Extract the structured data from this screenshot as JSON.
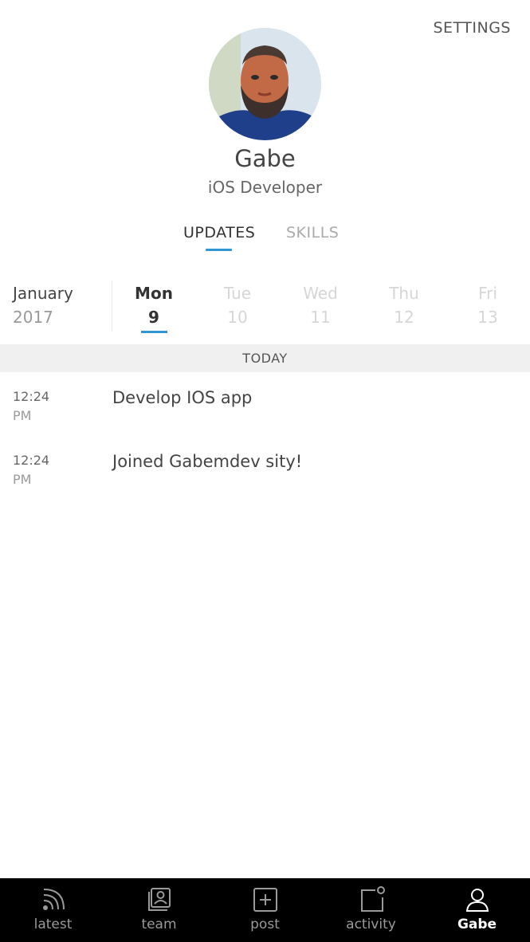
{
  "header": {
    "settings_label": "SETTINGS"
  },
  "profile": {
    "name": "Gabe",
    "role": "iOS Developer"
  },
  "profile_tabs": [
    {
      "label": "UPDATES",
      "active": true
    },
    {
      "label": "SKILLS",
      "active": false
    }
  ],
  "calendar": {
    "month": "January",
    "year": "2017",
    "days": [
      {
        "name": "Mon",
        "number": "9",
        "selected": true
      },
      {
        "name": "Tue",
        "number": "10",
        "selected": false
      },
      {
        "name": "Wed",
        "number": "11",
        "selected": false
      },
      {
        "name": "Thu",
        "number": "12",
        "selected": false
      },
      {
        "name": "Fri",
        "number": "13",
        "selected": false
      }
    ]
  },
  "section_header": "TODAY",
  "updates": [
    {
      "time": "12:24",
      "ampm": "PM",
      "text": "Develop IOS app"
    },
    {
      "time": "12:24",
      "ampm": "PM",
      "text": "Joined Gabemdev sity!"
    }
  ],
  "tabbar": [
    {
      "label": "latest",
      "icon": "rss-icon",
      "active": false
    },
    {
      "label": "team",
      "icon": "team-icon",
      "active": false
    },
    {
      "label": "post",
      "icon": "plus-square-icon",
      "active": false
    },
    {
      "label": "activity",
      "icon": "notification-icon",
      "active": false
    },
    {
      "label": "Gabe",
      "icon": "user-icon",
      "active": true
    }
  ],
  "colors": {
    "accent": "#2e97d1",
    "tabbar_bg": "#000000",
    "section_bg": "#f0f0f0"
  }
}
